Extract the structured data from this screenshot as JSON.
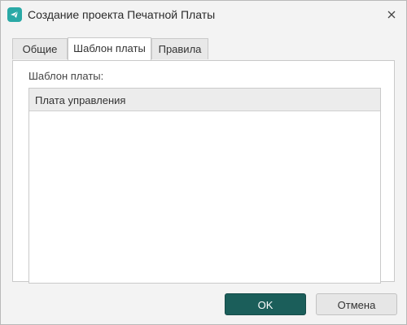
{
  "window": {
    "title": "Создание проекта Печатной Платы",
    "app_icon": "telegram-like-app-icon",
    "close_icon": "close-icon"
  },
  "tabs": [
    {
      "label": "Общие",
      "active": false
    },
    {
      "label": "Шаблон платы",
      "active": true
    },
    {
      "label": "Правила",
      "active": false
    }
  ],
  "panel": {
    "label": "Шаблон платы:",
    "list": {
      "columns": [
        "Плата управления"
      ],
      "rows": []
    }
  },
  "buttons": {
    "ok_label": "OK",
    "cancel_label": "Отмена"
  },
  "colors": {
    "accent": "#1b5e5a",
    "app_icon_bg": "#2aa9a6"
  }
}
